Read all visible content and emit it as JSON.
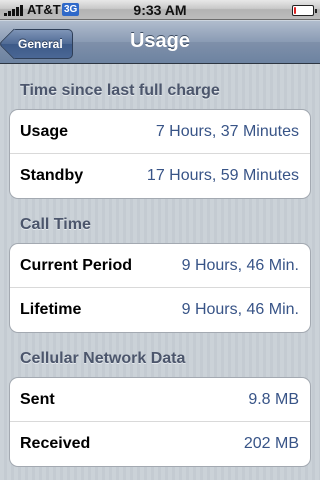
{
  "status_bar": {
    "carrier": "AT&T",
    "network": "3G",
    "time": "9:33 AM",
    "battery_level": 0.12
  },
  "nav": {
    "back_label": "General",
    "title": "Usage"
  },
  "sections": [
    {
      "header": "Time since last full charge",
      "rows": [
        {
          "label": "Usage",
          "value": "7 Hours, 37 Minutes"
        },
        {
          "label": "Standby",
          "value": "17 Hours, 59 Minutes"
        }
      ]
    },
    {
      "header": "Call Time",
      "rows": [
        {
          "label": "Current Period",
          "value": "9 Hours, 46 Min."
        },
        {
          "label": "Lifetime",
          "value": "9 Hours, 46 Min."
        }
      ]
    },
    {
      "header": "Cellular Network Data",
      "rows": [
        {
          "label": "Sent",
          "value": "9.8 MB"
        },
        {
          "label": "Received",
          "value": "202 MB"
        }
      ]
    }
  ],
  "colors": {
    "value_text": "#385487",
    "section_header": "#4c566c",
    "network_badge": "#2f69c9",
    "battery_low": "#dd2222"
  }
}
